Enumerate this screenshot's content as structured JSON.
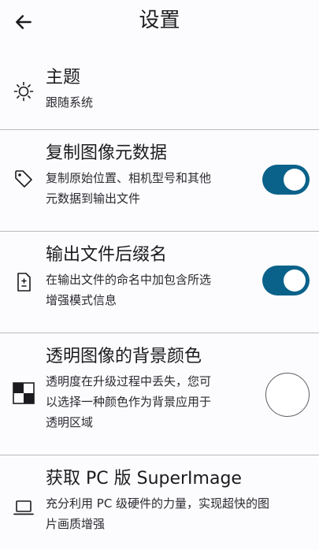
{
  "app_bar": {
    "title": "设置",
    "back_icon": "arrow-back-icon"
  },
  "settings": [
    {
      "label": "主题",
      "desc": "跟随系统",
      "icon": "sun-icon"
    },
    {
      "label": "复制图像元数据",
      "desc_lines": [
        "复制原始位置、相机型号和其他",
        "元数据到输出文件"
      ],
      "icon": "tag-icon",
      "toggle_on": true
    },
    {
      "label": "输出文件后缀名",
      "desc_lines": [
        "在输出文件的命名中加包含所选",
        "增强模式信息"
      ],
      "icon": "file-plus-minus-icon",
      "toggle_on": true
    },
    {
      "label": "透明图像的背景颜色",
      "desc_lines": [
        "透明度在升级过程中丢失，您可",
        "以选择一种颜色作为背景应用于",
        "透明区域"
      ],
      "icon": "checkerboard-icon",
      "color": "#ffffff"
    },
    {
      "label": "获取 PC 版 SuperImage",
      "desc_lines": [
        "充分利用 PC 级硬件的力量，实现超快的图",
        "片画质增强"
      ],
      "icon": "laptop-icon"
    }
  ],
  "colors": {
    "accent": "#0a628a",
    "divider": "#b9b9bf",
    "background": "#fcfcfe"
  }
}
